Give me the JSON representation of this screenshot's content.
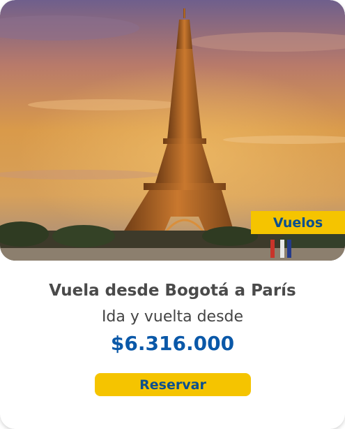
{
  "card": {
    "badge": "Vuelos",
    "title": "Vuela desde Bogotá a París",
    "subtitle": "Ida y vuelta desde",
    "price": "$6.316.000",
    "cta_label": "Reservar"
  },
  "colors": {
    "accent_yellow": "#f5c400",
    "brand_blue": "#0a58a8",
    "badge_text": "#0a4f8f"
  },
  "image": {
    "subject": "eiffel-tower-sunset"
  }
}
